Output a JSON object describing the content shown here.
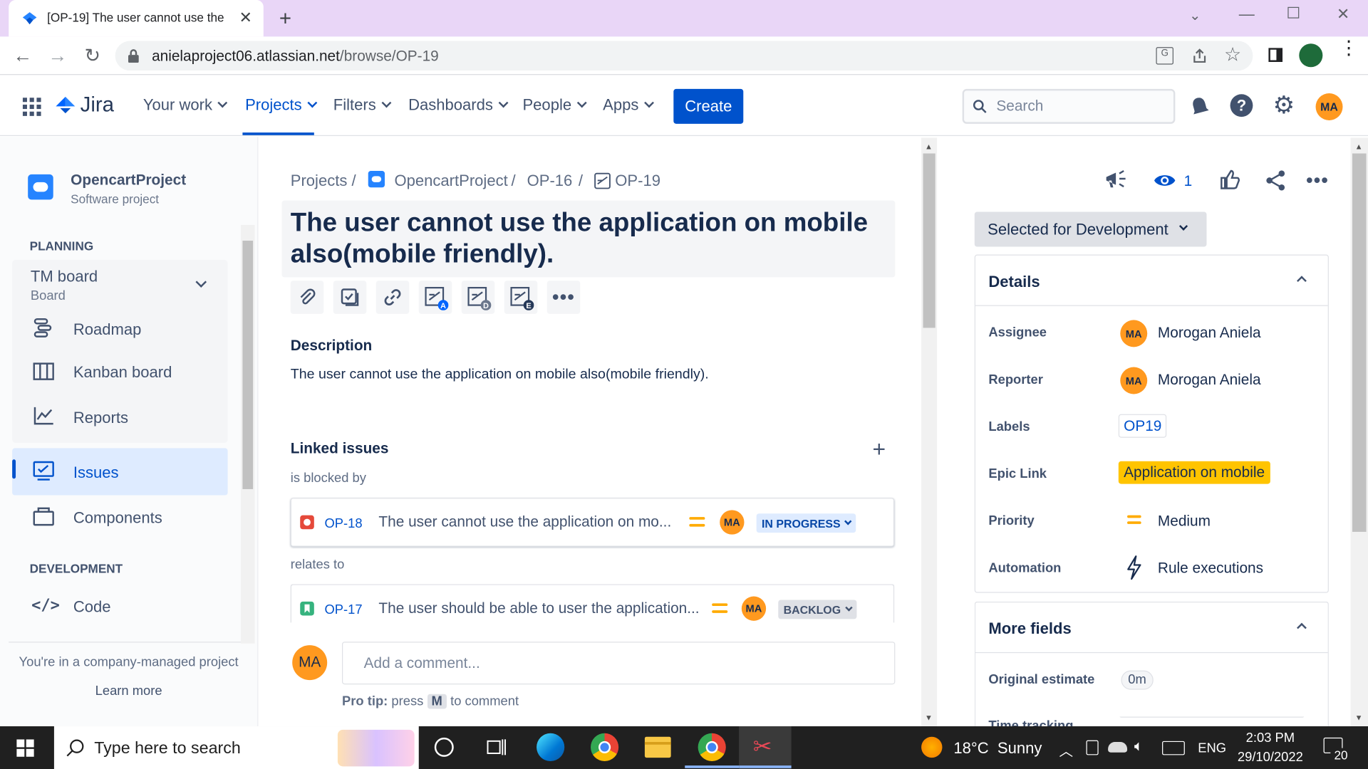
{
  "browser": {
    "tab_title": "[OP-19] The user cannot use the",
    "url_host": "anielaproject06.atlassian.net",
    "url_path": "/browse/OP-19"
  },
  "nav": {
    "product": "Jira",
    "items": [
      "Your work",
      "Projects",
      "Filters",
      "Dashboards",
      "People",
      "Apps"
    ],
    "active": "Projects",
    "create_label": "Create",
    "search_placeholder": "Search",
    "user_initials": "MA"
  },
  "sidebar": {
    "project_name": "OpencartProject",
    "project_type": "Software project",
    "planning_label": "PLANNING",
    "board_name": "TM board",
    "board_sub": "Board",
    "planning_items": [
      "Roadmap",
      "Kanban board",
      "Reports"
    ],
    "issues_label": "Issues",
    "components_label": "Components",
    "development_label": "DEVELOPMENT",
    "code_label": "Code",
    "footer_text": "You're in a company-managed project",
    "learn_more": "Learn more"
  },
  "issue": {
    "breadcrumb": [
      "Projects",
      "OpencartProject",
      "OP-16",
      "OP-19"
    ],
    "title": "The user cannot use the application on mobile also(mobile friendly).",
    "description_label": "Description",
    "description": "The user cannot use the application on mobile also(mobile friendly).",
    "linked_label": "Linked issues",
    "blocked_by_label": "is blocked by",
    "relates_to_label": "relates to",
    "linked": [
      {
        "key": "OP-18",
        "summary": "The user cannot use the application on mo...",
        "status": "IN PROGRESS",
        "assignee": "MA"
      },
      {
        "key": "OP-17",
        "summary": "The user should be able to user the application...",
        "status": "BACKLOG",
        "assignee": "MA"
      }
    ],
    "comment_placeholder": "Add a comment...",
    "commenter_initials": "MA",
    "pro_tip_prefix": "Pro tip:",
    "pro_tip_press": "press",
    "pro_tip_key": "M",
    "pro_tip_suffix": "to comment"
  },
  "right": {
    "watch_count": "1",
    "status": "Selected for Development",
    "details_label": "Details",
    "fields": [
      {
        "label": "Assignee",
        "value": "Morogan Aniela",
        "initials": "MA"
      },
      {
        "label": "Reporter",
        "value": "Morogan Aniela",
        "initials": "MA"
      },
      {
        "label": "Labels",
        "value": "OP19"
      },
      {
        "label": "Epic Link",
        "value": "Application on mobile"
      },
      {
        "label": "Priority",
        "value": "Medium"
      },
      {
        "label": "Automation",
        "value": "Rule executions"
      }
    ],
    "more_fields_label": "More fields",
    "original_estimate_label": "Original estimate",
    "original_estimate_value": "0m",
    "time_tracking_label": "Time tracking"
  },
  "taskbar": {
    "search_placeholder": "Type here to search",
    "weather": "18°C  Sunny",
    "lang": "ENG",
    "time": "2:03 PM",
    "date": "29/10/2022",
    "notifications": "20"
  },
  "colors": {
    "brand": "#0052cc",
    "epic": "#ffc400",
    "avatar": "#ff991f"
  }
}
